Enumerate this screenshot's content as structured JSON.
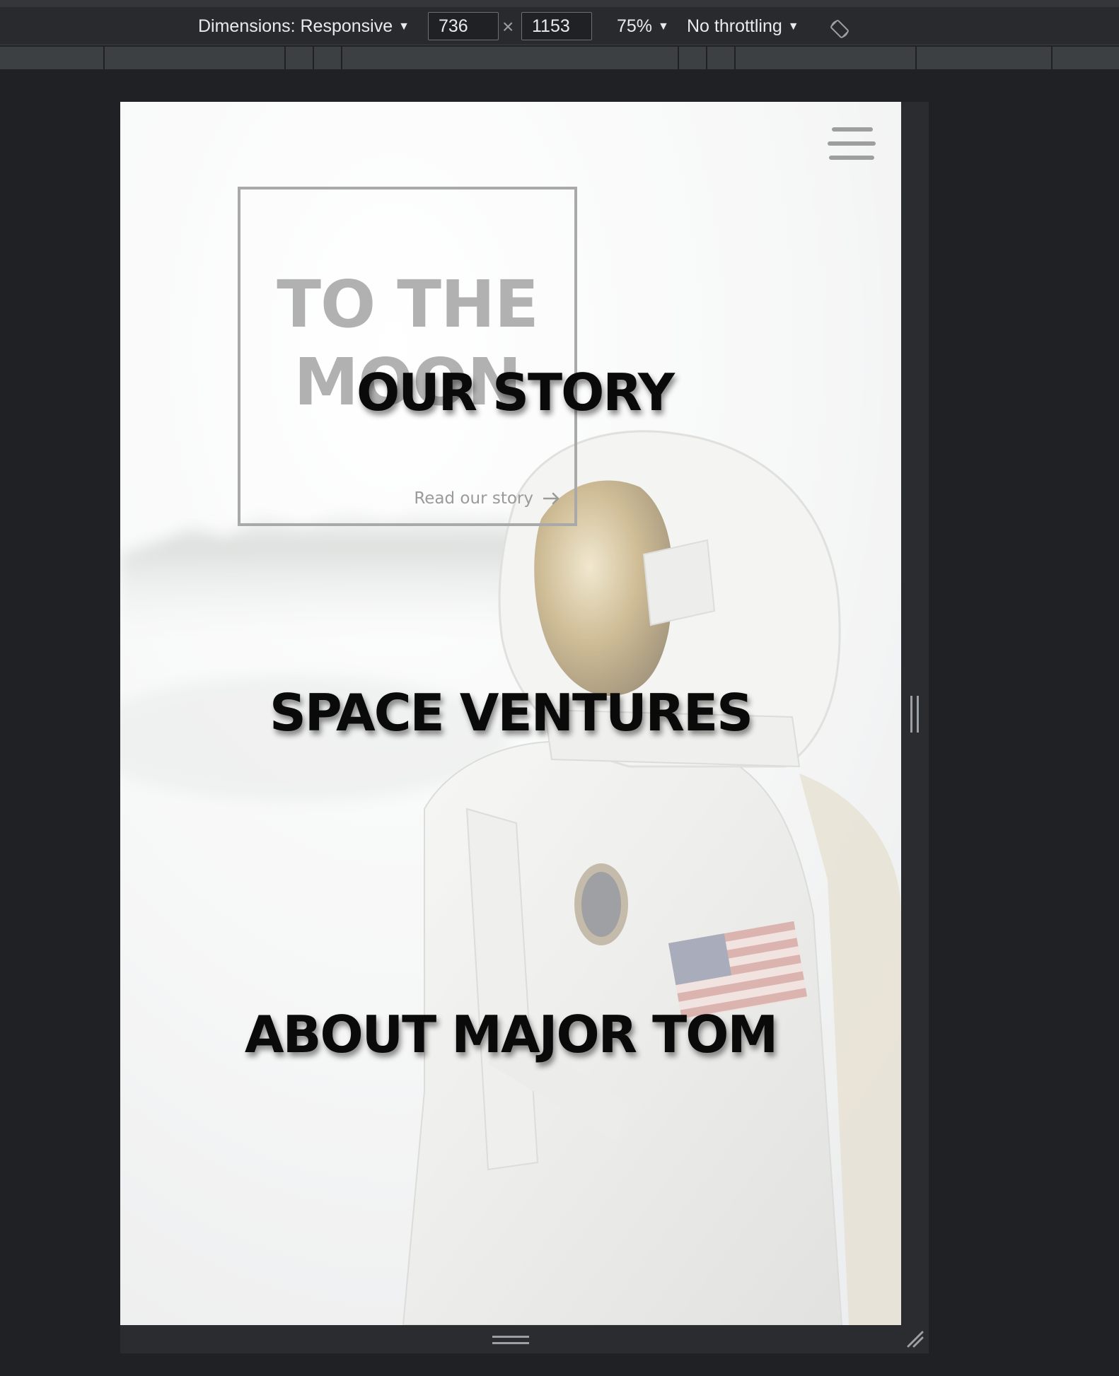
{
  "devtools": {
    "dimensions_label": "Dimensions: Responsive",
    "width_value": "736",
    "height_value": "1153",
    "times_symbol": "×",
    "zoom_label": "75%",
    "throttling_label": "No throttling",
    "caret": "▼",
    "rotate_icon": "rotate-icon"
  },
  "page": {
    "menu_icon": "hamburger-menu-icon",
    "hero": {
      "title_line1": "TO THE",
      "title_line2": "MOON",
      "read_link": "Read our story",
      "link_icon": "arrow-right-icon"
    },
    "nav_overlay": [
      {
        "label": "OUR STORY"
      },
      {
        "label": "SPACE VENTURES"
      },
      {
        "label": "ABOUT MAJOR TOM"
      }
    ]
  },
  "colors": {
    "devtools_bg": "#292a2d",
    "page_overlay_text": "#0a0a0a",
    "hero_text": "#b1b1b1"
  }
}
